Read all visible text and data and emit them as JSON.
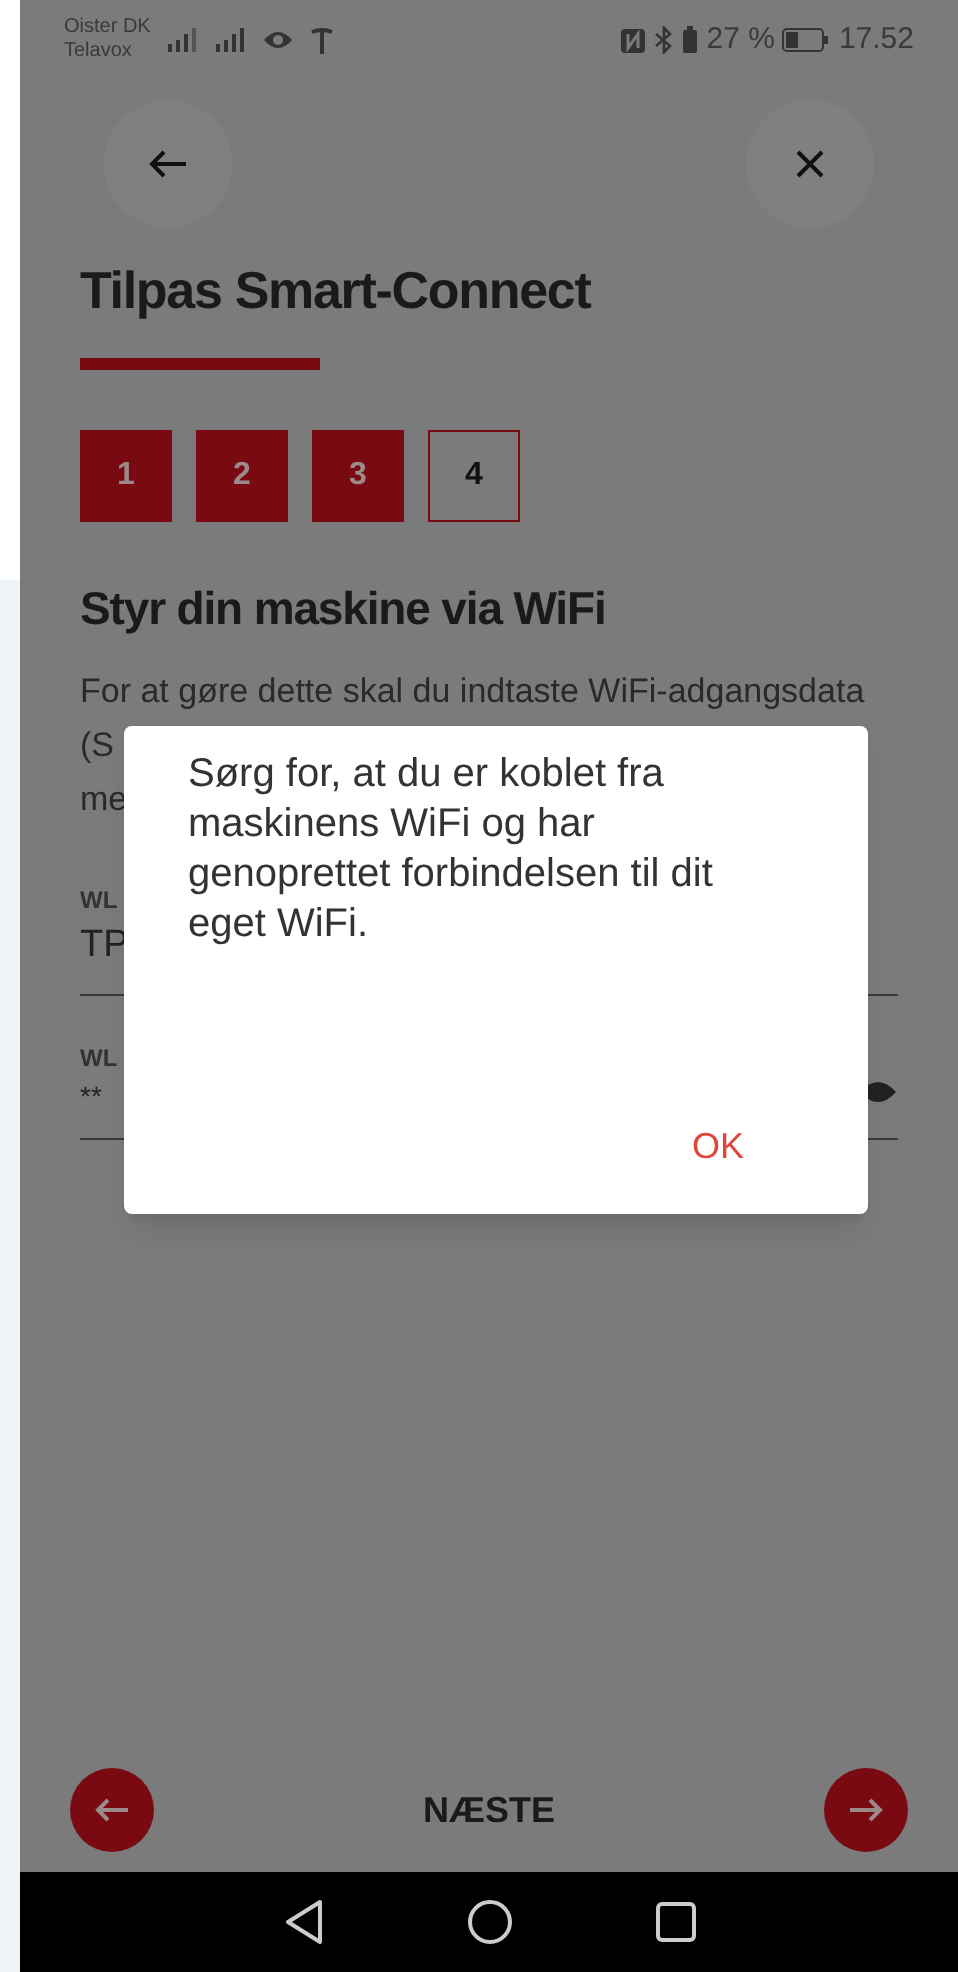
{
  "status_bar": {
    "carrier_1": "Oister DK",
    "carrier_2": "Telavox",
    "battery_percent": "27 %",
    "time": "17.52"
  },
  "title": "Tilpas Smart-Connect",
  "steps": [
    {
      "label": "1",
      "completed": true
    },
    {
      "label": "2",
      "completed": true
    },
    {
      "label": "3",
      "completed": true
    },
    {
      "label": "4",
      "completed": false
    }
  ],
  "heading": "Styr din maskine via WiFi",
  "description_lines": [
    "For at gøre dette skal du indtaste WiFi-adgangsdata",
    "(S",
    "me"
  ],
  "fields": [
    {
      "label": "WL",
      "value": "TP",
      "kind": "text"
    },
    {
      "label": "WL",
      "value": "**",
      "kind": "password"
    }
  ],
  "dialog": {
    "message": "Sørg for, at du er koblet fra maskinens WiFi og har genoprettet forbindelsen til dit eget WiFi.",
    "button": "OK"
  },
  "footer": {
    "next_label": "NÆSTE"
  }
}
